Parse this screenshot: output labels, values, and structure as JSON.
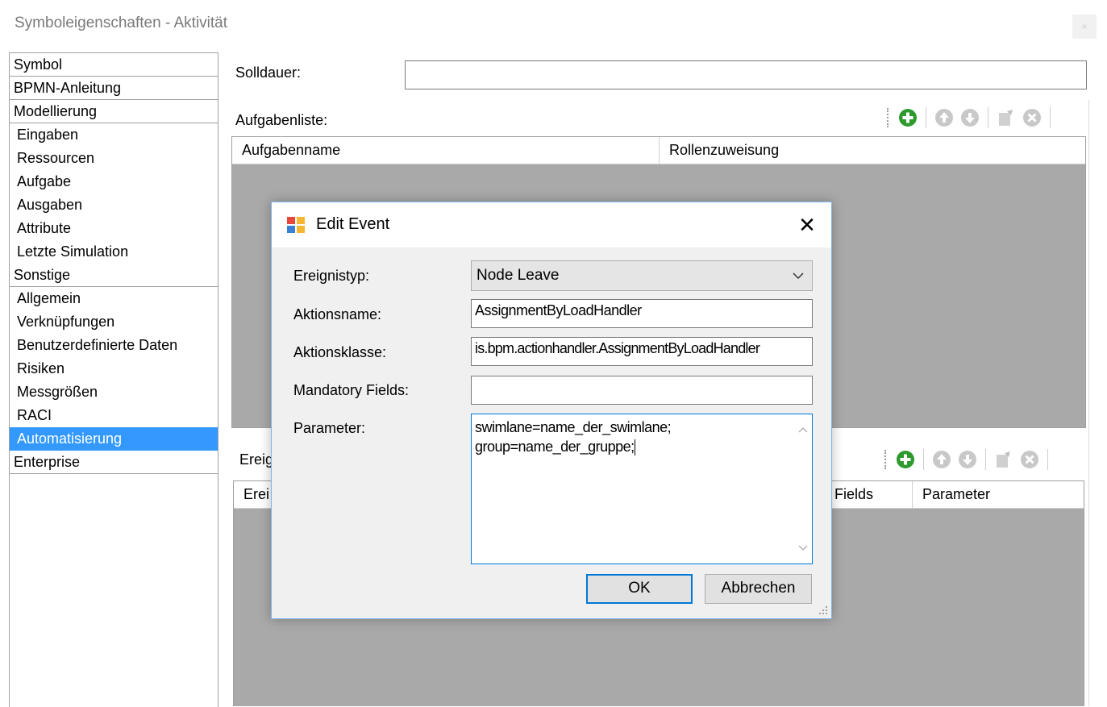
{
  "window": {
    "title": "Symboleigenschaften - Aktivität",
    "close_glyph": "×"
  },
  "nav": [
    {
      "label": "Symbol",
      "category": true
    },
    {
      "label": "BPMN-Anleitung",
      "category": true
    },
    {
      "label": "Modellierung",
      "category": true
    },
    {
      "label": "Eingaben"
    },
    {
      "label": "Ressourcen"
    },
    {
      "label": "Aufgabe"
    },
    {
      "label": "Ausgaben"
    },
    {
      "label": "Attribute"
    },
    {
      "label": "Letzte Simulation"
    },
    {
      "label": "Sonstige",
      "category": true
    },
    {
      "label": "Allgemein"
    },
    {
      "label": "Verknüpfungen"
    },
    {
      "label": "Benutzerdefinierte Daten"
    },
    {
      "label": "Risiken"
    },
    {
      "label": "Messgrößen"
    },
    {
      "label": "RACI"
    },
    {
      "label": "Automatisierung",
      "selected": true
    },
    {
      "label": "Enterprise",
      "category": true
    }
  ],
  "main": {
    "solldauer_label": "Solldauer:",
    "solldauer_value": "",
    "tasklist_label": "Aufgabenliste:",
    "tasklist_columns": [
      "Aufgabenname",
      "Rollenzuweisung"
    ],
    "events_label": "Ereignisse:",
    "events_label_visible": "Ereig",
    "events_columns_visible": [
      "Erei",
      "Fields",
      "Parameter"
    ]
  },
  "toolbar_icons": [
    "add-icon",
    "move-up-icon",
    "move-down-icon",
    "edit-icon",
    "delete-icon"
  ],
  "colors": {
    "selection": "#3399ff",
    "add": "#2e9a2e",
    "accent": "#0078d7",
    "disabled_icon": "#c8c8c8"
  },
  "dialog": {
    "title": "Edit Event",
    "close_glyph": "✕",
    "event_type_label": "Ereignistyp:",
    "event_type_value": "Node Leave",
    "action_name_label": "Aktionsname:",
    "action_name_value": "AssignmentByLoadHandler",
    "action_class_label": "Aktionsklasse:",
    "action_class_value": "is.bpm.actionhandler.AssignmentByLoadHandler",
    "mandatory_label": "Mandatory Fields:",
    "mandatory_value": "",
    "parameter_label": "Parameter:",
    "parameter_lines": [
      "swimlane=name_der_swimlane;",
      "group=name_der_gruppe;"
    ],
    "ok_label": "OK",
    "cancel_label": "Abbrechen"
  }
}
